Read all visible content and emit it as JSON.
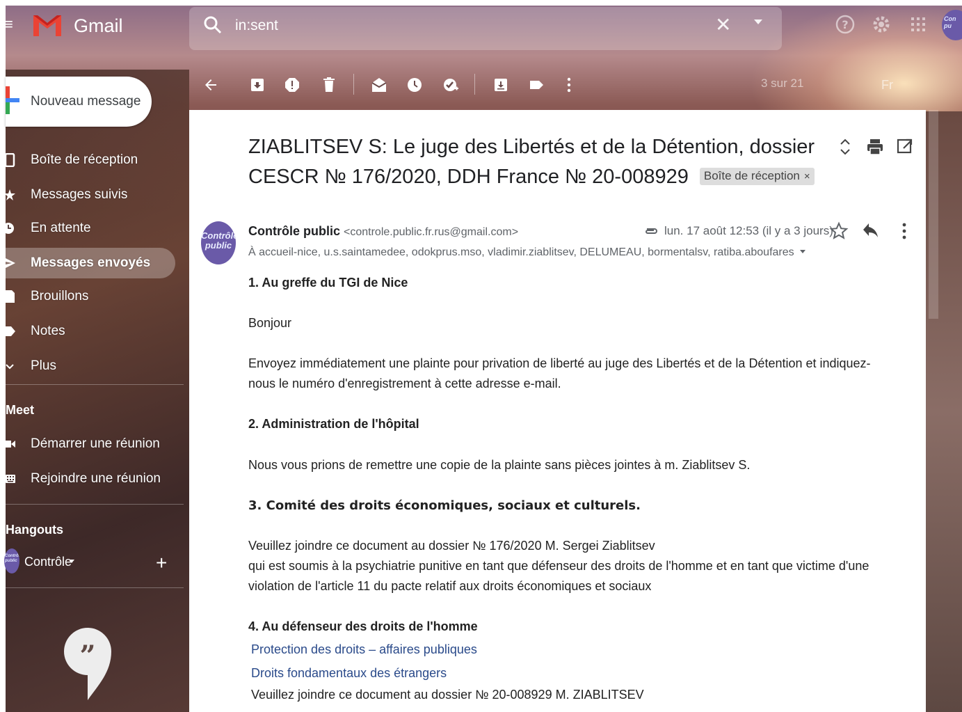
{
  "app": {
    "name": "Gmail"
  },
  "search": {
    "value": "in:sent"
  },
  "toolbar": {
    "counter": "3 sur 21",
    "lang": "Fr"
  },
  "sidebar": {
    "compose_label": "Nouveau message",
    "items": [
      {
        "label": "Boîte de réception"
      },
      {
        "label": "Messages suivis"
      },
      {
        "label": "En attente"
      },
      {
        "label": "Messages envoyés"
      },
      {
        "label": "Brouillons"
      },
      {
        "label": "Notes"
      },
      {
        "label": "Plus"
      }
    ],
    "meet": {
      "title": "Meet",
      "items": [
        {
          "label": "Démarrer une réunion"
        },
        {
          "label": "Rejoindre une réunion"
        }
      ]
    },
    "hangouts": {
      "title": "Hangouts",
      "user": "Contrôle",
      "avatar_text": "Contrôle public"
    }
  },
  "message": {
    "subject": "ZIABLITSEV S: Le juge des Libertés et de la Détention, dossier CESCR № 176/2020, DDH France № 20-008929",
    "label_chip": "Boîte de réception",
    "sender_name": "Contrôle public",
    "sender_email": "<controle.public.fr.rus@gmail.com>",
    "avatar_text": "Contrôle public",
    "date": "lun. 17 août 12:53 (il y a 3 jours)",
    "recipients": "À accueil-nice, u.s.saintamedee, odokprus.mso, vladimir.ziablitsev, DELUMEAU, bormentalsv, ratiba.aboufares",
    "body": {
      "h1": "1. Au greffe du TGI de Nice",
      "greeting": "Bonjour",
      "p1": " Envoyez immédiatement une plainte pour privation de liberté au juge des Libertés et de la  Détention et indiquez-nous le numéro d'enregistrement à cette adresse e-mail.",
      "h2": "2. Administration de l'hôpital",
      "p2": "Nous vous prions de remettre une copie de la plainte sans pièces jointes à m. Ziablitsev S.",
      "h3": "3. Comité des droits économiques, sociaux et culturels.",
      "p3a": "Veuillez joindre ce document au dossier  № 176/2020 M. Sergei Ziablitsev",
      "p3b": "qui est soumis à la psychiatrie punitive en tant que défenseur des droits de l'homme  et en tant que victime  d'une violation de l'article 11 du pacte relatif aux droits économiques et sociaux",
      "h4": "4. Au défenseur des droits de l'homme",
      "link1": "Protection des droits – affaires publiques",
      "link2": "Droits fondamentaux des étrangers",
      "p4": "Veuillez joindre ce document au dossier  № 20-008929 M.  ZIABLITSEV"
    }
  }
}
